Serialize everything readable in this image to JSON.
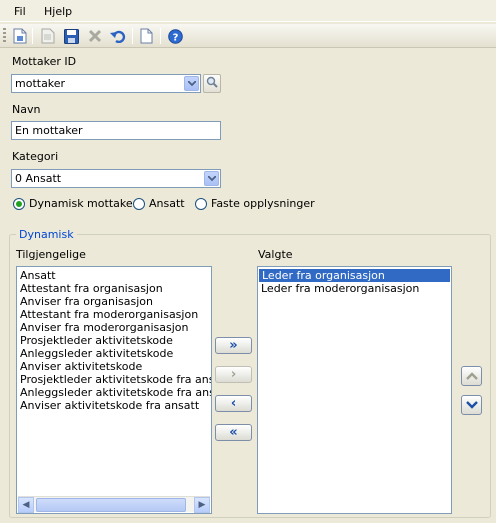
{
  "menu": {
    "file": "Fil",
    "help": "Hjelp"
  },
  "toolbar": {
    "icons": [
      "new-doc-icon",
      "page-icon",
      "save-icon",
      "delete-icon",
      "undo-icon",
      "blank-page-icon",
      "help-icon"
    ]
  },
  "recipient": {
    "label": "Mottaker ID",
    "value": "mottaker"
  },
  "name": {
    "label": "Navn",
    "value": "En mottaker"
  },
  "category": {
    "label": "Kategori",
    "value": "0 Ansatt"
  },
  "radios": [
    {
      "label": "Dynamisk mottaker",
      "checked": true
    },
    {
      "label": "Ansatt",
      "checked": false
    },
    {
      "label": "Faste opplysninger",
      "checked": false
    }
  ],
  "dynamic": {
    "title": "Dynamisk",
    "available_label": "Tilgjengelige",
    "selected_label": "Valgte",
    "available": [
      "Ansatt",
      "Attestant fra organisasjon",
      "Anviser fra organisasjon",
      "Attestant fra moderorganisasjon",
      "Anviser fra moderorganisasjon",
      "Prosjektleder aktivitetskode",
      "Anleggsleder aktivitetskode",
      "Anviser aktivitetskode",
      "Prosjektleder aktivitetskode fra ansatt",
      "Anleggsleder aktivitetskode fra ansatt",
      "Anviser aktivitetskode fra ansatt"
    ],
    "selected": [
      "Leder fra organisasjon",
      "Leder fra moderorganisasjon"
    ],
    "buttons": {
      "add_all": "»",
      "add": "›",
      "remove": "‹",
      "remove_all": "«"
    }
  },
  "colors": {
    "accent": "#316ac5",
    "group_title": "#0046d5"
  }
}
